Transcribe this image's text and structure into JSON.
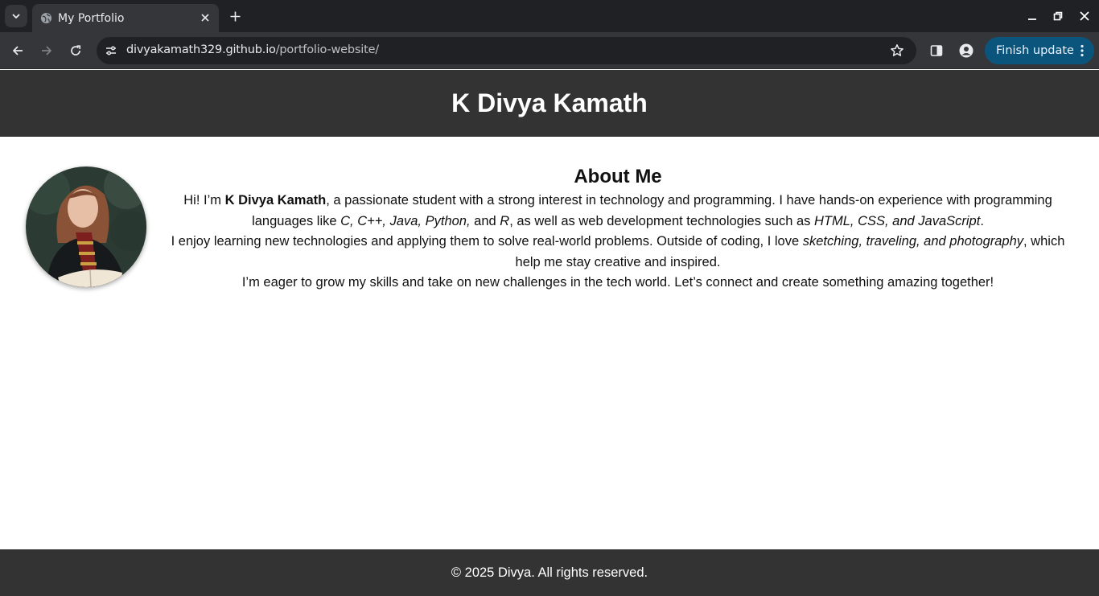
{
  "browser": {
    "tab_title": "My Portfolio",
    "url_host": "divyakamath329.github.io",
    "url_path": "/portfolio-website/",
    "update_button_label": "Finish update",
    "accent_color": "#0b557d"
  },
  "header": {
    "title": "K Divya Kamath"
  },
  "about": {
    "heading": "About Me",
    "p1_intro": "Hi! I’m ",
    "p1_name": "K Divya Kamath",
    "p1_mid": ", a passionate student with a strong interest in technology and programming. I have hands-on experience with programming languages like ",
    "p1_langs": "C, C++, Java, Python,",
    "p1_and": " and ",
    "p1_r": "R",
    "p1_web": ", as well as web development technologies such as ",
    "p1_webtech": "HTML, CSS, and JavaScript",
    "p1_end": ".",
    "p2_start": "I enjoy learning new technologies and applying them to solve real-world problems. Outside of coding, I love ",
    "p2_hobbies": "sketching, traveling, and photography",
    "p2_end": ", which help me stay creative and inspired.",
    "p3": "I’m eager to grow my skills and take on new challenges in the tech world. Let’s connect and create something amazing together!"
  },
  "footer": {
    "copyright": "© 2025 Divya. All rights reserved."
  }
}
